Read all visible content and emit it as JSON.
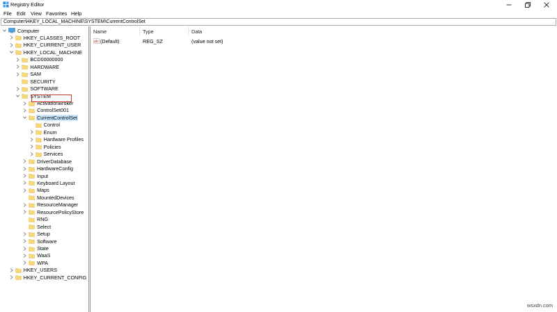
{
  "window": {
    "title": "Registry Editor",
    "controls": [
      "minimize",
      "maximize",
      "close"
    ]
  },
  "menu": [
    "File",
    "Edit",
    "View",
    "Favorites",
    "Help"
  ],
  "address": "Computer\\HKEY_LOCAL_MACHINE\\SYSTEM\\CurrentControlSet",
  "tree": [
    {
      "label": "Computer",
      "indent": 0,
      "expander": "down",
      "icon": "computer-icon"
    },
    {
      "label": "HKEY_CLASSES_ROOT",
      "indent": 1,
      "expander": "right",
      "icon": "folder-icon"
    },
    {
      "label": "HKEY_CURRENT_USER",
      "indent": 1,
      "expander": "right",
      "icon": "folder-icon"
    },
    {
      "label": "HKEY_LOCAL_MACHINE",
      "indent": 1,
      "expander": "down",
      "icon": "folder-icon"
    },
    {
      "label": "BCD00000000",
      "indent": 2,
      "expander": "right",
      "icon": "folder-icon"
    },
    {
      "label": "HARDWARE",
      "indent": 2,
      "expander": "right",
      "icon": "folder-icon"
    },
    {
      "label": "SAM",
      "indent": 2,
      "expander": "right",
      "icon": "folder-icon"
    },
    {
      "label": "SECURITY",
      "indent": 2,
      "expander": "none",
      "icon": "folder-icon"
    },
    {
      "label": "SOFTWARE",
      "indent": 2,
      "expander": "right",
      "icon": "folder-icon"
    },
    {
      "label": "SYSTEM",
      "indent": 2,
      "expander": "down",
      "icon": "folder-icon"
    },
    {
      "label": "ActivationBroker",
      "indent": 3,
      "expander": "right",
      "icon": "folder-icon"
    },
    {
      "label": "ControlSet001",
      "indent": 3,
      "expander": "right",
      "icon": "folder-icon"
    },
    {
      "label": "CurrentControlSet",
      "indent": 3,
      "expander": "down",
      "icon": "folder-icon",
      "selected": true
    },
    {
      "label": "Control",
      "indent": 4,
      "expander": "none",
      "icon": "folder-icon",
      "highlighted": true
    },
    {
      "label": "Enum",
      "indent": 4,
      "expander": "right",
      "icon": "folder-icon"
    },
    {
      "label": "Hardware Profiles",
      "indent": 4,
      "expander": "right",
      "icon": "folder-icon"
    },
    {
      "label": "Policies",
      "indent": 4,
      "expander": "right",
      "icon": "folder-icon"
    },
    {
      "label": "Services",
      "indent": 4,
      "expander": "right",
      "icon": "folder-icon"
    },
    {
      "label": "DriverDatabase",
      "indent": 3,
      "expander": "right",
      "icon": "folder-icon"
    },
    {
      "label": "HardwareConfig",
      "indent": 3,
      "expander": "right",
      "icon": "folder-icon"
    },
    {
      "label": "Input",
      "indent": 3,
      "expander": "right",
      "icon": "folder-icon"
    },
    {
      "label": "Keyboard Layout",
      "indent": 3,
      "expander": "right",
      "icon": "folder-icon"
    },
    {
      "label": "Maps",
      "indent": 3,
      "expander": "right",
      "icon": "folder-icon"
    },
    {
      "label": "MountedDevices",
      "indent": 3,
      "expander": "none",
      "icon": "folder-icon"
    },
    {
      "label": "ResourceManager",
      "indent": 3,
      "expander": "right",
      "icon": "folder-icon"
    },
    {
      "label": "ResourcePolicyStore",
      "indent": 3,
      "expander": "right",
      "icon": "folder-icon"
    },
    {
      "label": "RNG",
      "indent": 3,
      "expander": "none",
      "icon": "folder-icon"
    },
    {
      "label": "Select",
      "indent": 3,
      "expander": "none",
      "icon": "folder-icon"
    },
    {
      "label": "Setup",
      "indent": 3,
      "expander": "right",
      "icon": "folder-icon"
    },
    {
      "label": "Software",
      "indent": 3,
      "expander": "right",
      "icon": "folder-icon"
    },
    {
      "label": "State",
      "indent": 3,
      "expander": "right",
      "icon": "folder-icon"
    },
    {
      "label": "WaaS",
      "indent": 3,
      "expander": "right",
      "icon": "folder-icon"
    },
    {
      "label": "WPA",
      "indent": 3,
      "expander": "right",
      "icon": "folder-icon"
    },
    {
      "label": "HKEY_USERS",
      "indent": 1,
      "expander": "right",
      "icon": "folder-icon"
    },
    {
      "label": "HKEY_CURRENT_CONFIG",
      "indent": 1,
      "expander": "right",
      "icon": "folder-icon"
    }
  ],
  "list": {
    "columns": [
      "Name",
      "Type",
      "Data"
    ],
    "rows": [
      {
        "name": "(Default)",
        "type": "REG_SZ",
        "data": "(value not set)",
        "icon": "string-value-icon"
      }
    ]
  },
  "watermark": "wsxdn.com",
  "colors": {
    "folder": "#f8d775",
    "selection": "#cce8ff",
    "highlight_border": "#c0392b"
  }
}
